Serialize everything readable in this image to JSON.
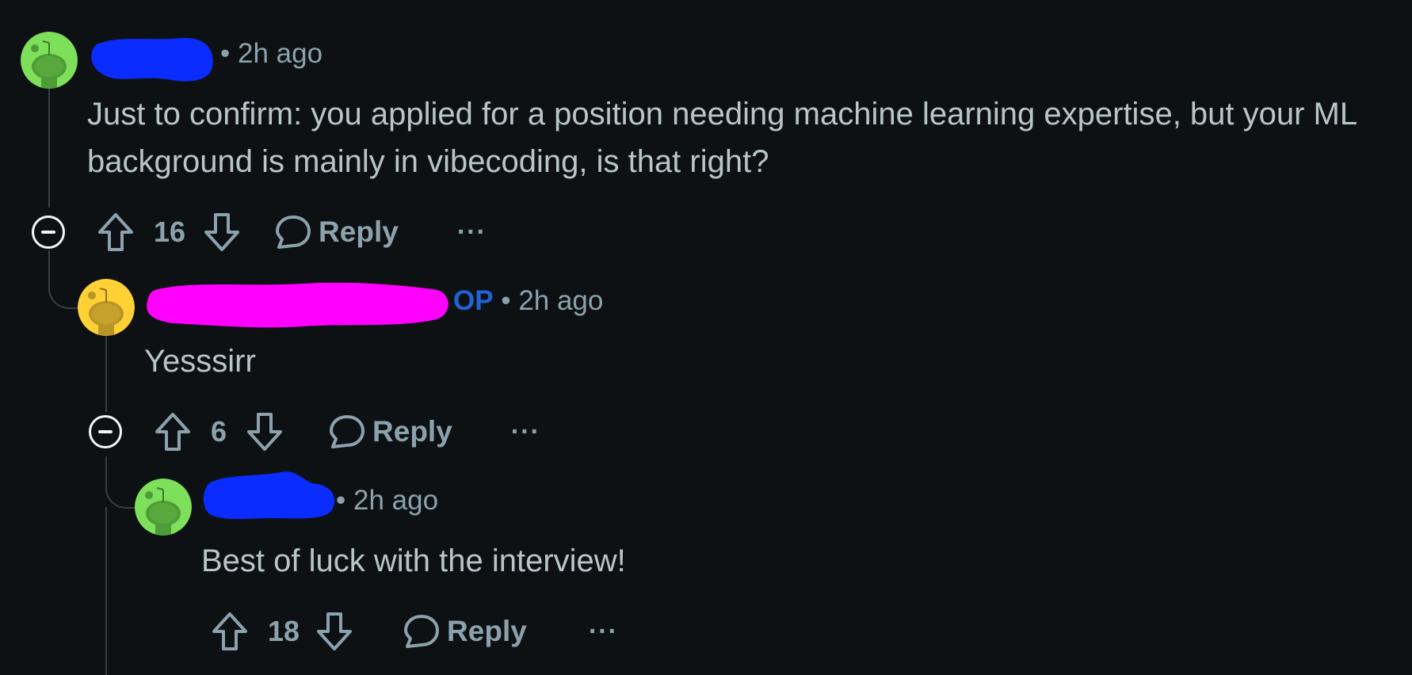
{
  "comments": [
    {
      "id": "c1",
      "time": "2h ago",
      "avatar_color": "#7ee05a",
      "redact_color": "#0a2cff",
      "body": "Just to confirm: you applied for a position needing machine learning expertise, but your ML background is mainly in vibecoding, is that right?",
      "votes": "16",
      "reply_label": "Reply",
      "more_label": "···"
    },
    {
      "id": "c2",
      "op_label": "OP",
      "time": "2h ago",
      "avatar_color": "#ffd135",
      "redact_color": "#ff00ff",
      "body": "Yesssirr",
      "votes": "6",
      "reply_label": "Reply",
      "more_label": "···"
    },
    {
      "id": "c3",
      "time": "2h ago",
      "avatar_color": "#7ee05a",
      "redact_color": "#0a2cff",
      "body": "Best of luck with the interview!",
      "votes": "18",
      "reply_label": "Reply",
      "more_label": "···"
    }
  ],
  "separator": "•",
  "icons": {
    "collapse": "minus-circle-icon",
    "upvote": "arrow-up-icon",
    "downvote": "arrow-down-icon",
    "reply": "speech-bubble-icon",
    "more": "ellipsis-icon",
    "avatar": "snoo-icon"
  },
  "colors": {
    "background": "#0e1113",
    "text": "#b8c5c9",
    "meta": "#8ba2ad",
    "op": "#1f63d6",
    "thread_line": "#3a3f42"
  }
}
